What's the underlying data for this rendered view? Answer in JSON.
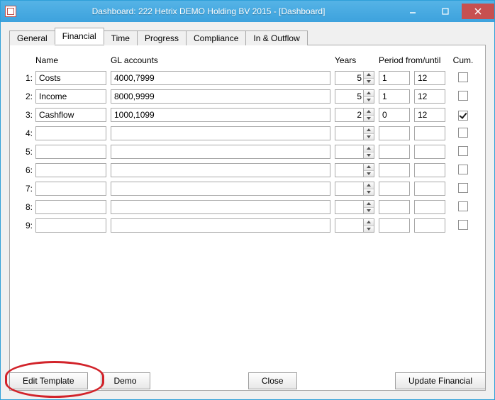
{
  "window": {
    "title": "Dashboard: 222 Hetrix DEMO Holding BV 2015 - [Dashboard]"
  },
  "tabs": [
    {
      "label": "General"
    },
    {
      "label": "Financial"
    },
    {
      "label": "Time"
    },
    {
      "label": "Progress"
    },
    {
      "label": "Compliance"
    },
    {
      "label": "In & Outflow"
    }
  ],
  "active_tab_index": 1,
  "headers": {
    "name": "Name",
    "gl": "GL accounts",
    "years": "Years",
    "period": "Period from/until",
    "cum": "Cum."
  },
  "rows": [
    {
      "idx": "1:",
      "name": "Costs",
      "gl": "4000,7999",
      "years": "5",
      "pf": "1",
      "pu": "12",
      "cum": false
    },
    {
      "idx": "2:",
      "name": "Income",
      "gl": "8000,9999",
      "years": "5",
      "pf": "1",
      "pu": "12",
      "cum": false
    },
    {
      "idx": "3:",
      "name": "Cashflow",
      "gl": "1000,1099",
      "years": "2",
      "pf": "0",
      "pu": "12",
      "cum": true
    },
    {
      "idx": "4:",
      "name": "",
      "gl": "",
      "years": "",
      "pf": "",
      "pu": "",
      "cum": false
    },
    {
      "idx": "5:",
      "name": "",
      "gl": "",
      "years": "",
      "pf": "",
      "pu": "",
      "cum": false
    },
    {
      "idx": "6:",
      "name": "",
      "gl": "",
      "years": "",
      "pf": "",
      "pu": "",
      "cum": false
    },
    {
      "idx": "7:",
      "name": "",
      "gl": "",
      "years": "",
      "pf": "",
      "pu": "",
      "cum": false
    },
    {
      "idx": "8:",
      "name": "",
      "gl": "",
      "years": "",
      "pf": "",
      "pu": "",
      "cum": false
    },
    {
      "idx": "9:",
      "name": "",
      "gl": "",
      "years": "",
      "pf": "",
      "pu": "",
      "cum": false
    }
  ],
  "buttons": {
    "edit_template": "Edit Template",
    "demo": "Demo",
    "close": "Close",
    "update_financial": "Update Financial"
  }
}
